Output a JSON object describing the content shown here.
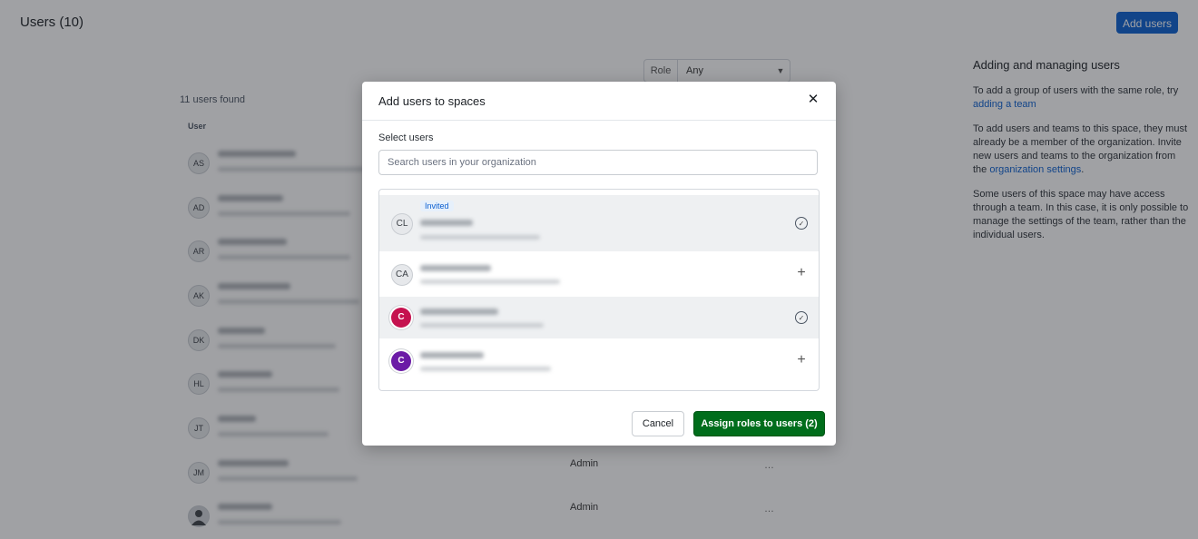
{
  "header": {
    "title": "Users (10)",
    "add_users_label": "Add users"
  },
  "filter": {
    "label": "Role",
    "value": "Any"
  },
  "users_found": "11 users found",
  "table": {
    "column_user": "User",
    "rows": [
      {
        "initials": "AS",
        "role": "",
        "photo": false
      },
      {
        "initials": "AD",
        "role": "",
        "photo": false
      },
      {
        "initials": "AR",
        "role": "",
        "photo": false
      },
      {
        "initials": "AK",
        "role": "",
        "photo": false
      },
      {
        "initials": "DK",
        "role": "",
        "photo": false
      },
      {
        "initials": "HL",
        "role": "",
        "photo": false
      },
      {
        "initials": "JT",
        "role": "",
        "photo": false
      },
      {
        "initials": "JM",
        "role": "Admin",
        "photo": false
      },
      {
        "initials": "",
        "role": "Admin",
        "photo": true
      }
    ]
  },
  "side_panel": {
    "title": "Adding and managing users",
    "p1_text": "To add a group of users with the same role, try ",
    "p1_link": "adding a team",
    "p2_text": "To add users and teams to this space, they must already be a member of the organization. Invite new users and teams to the organization from the ",
    "p2_link": "organization settings",
    "p2_end": ".",
    "p3_text": "Some users of this space may have access through a team. In this case, it is only possible to manage the settings of the team, rather than the individual users."
  },
  "modal": {
    "title": "Add users to spaces",
    "close_icon": "close-icon",
    "select_label": "Select users",
    "search_placeholder": "Search users in your organization",
    "items": [
      {
        "initials": "CL",
        "avatar_style": "gray",
        "badge": "Invited",
        "selected": true,
        "action_icon": "check-circle-icon",
        "action_glyph": "✓"
      },
      {
        "initials": "CA",
        "avatar_style": "gray",
        "badge": "",
        "selected": false,
        "action_icon": "plus-icon",
        "action_glyph": "+"
      },
      {
        "initials": "C",
        "avatar_style": "red",
        "badge": "",
        "selected": true,
        "action_icon": "check-circle-icon",
        "action_glyph": "✓"
      },
      {
        "initials": "C",
        "avatar_style": "purple",
        "badge": "",
        "selected": false,
        "action_icon": "plus-icon",
        "action_glyph": "+"
      }
    ],
    "cancel_label": "Cancel",
    "assign_label": "Assign roles to users (2)"
  },
  "colors": {
    "primary_blue": "#0a5fd1",
    "assign_green": "#006d1b",
    "avatar_red": "#c5124f",
    "avatar_purple": "#6b1aa6"
  }
}
